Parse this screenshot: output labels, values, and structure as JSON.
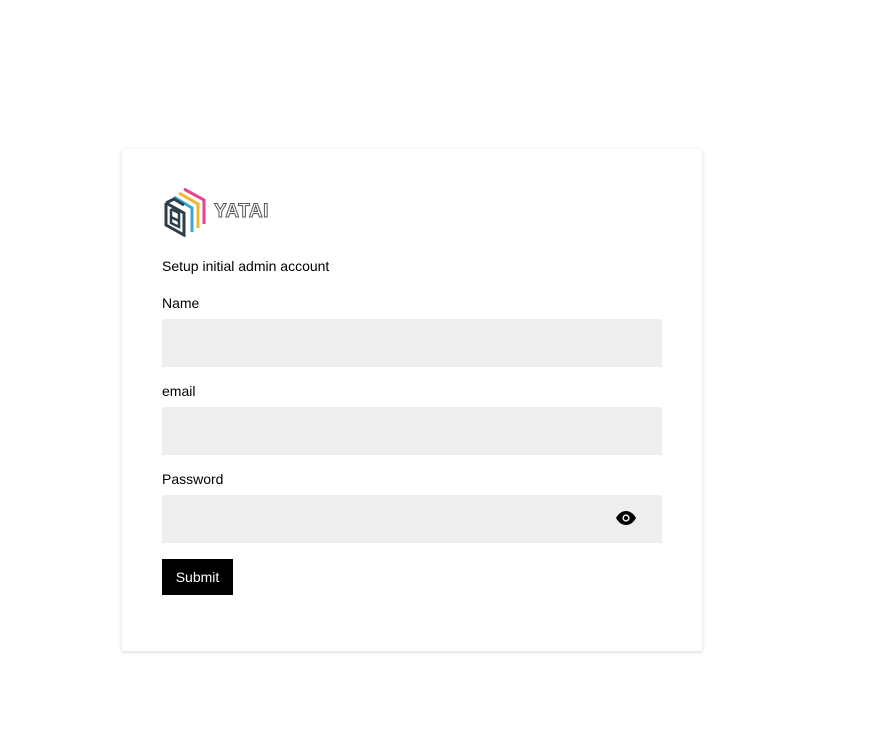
{
  "brand": {
    "name": "YATAI",
    "logo_colors": [
      "#e84393",
      "#f5b431",
      "#3aa6d8",
      "#2d3e4a"
    ]
  },
  "form": {
    "subtitle": "Setup initial admin account",
    "fields": [
      {
        "label": "Name",
        "value": "",
        "placeholder": ""
      },
      {
        "label": "email",
        "value": "",
        "placeholder": ""
      },
      {
        "label": "Password",
        "value": "",
        "placeholder": "",
        "toggle_icon": "eye-icon"
      }
    ],
    "submit_label": "Submit"
  }
}
